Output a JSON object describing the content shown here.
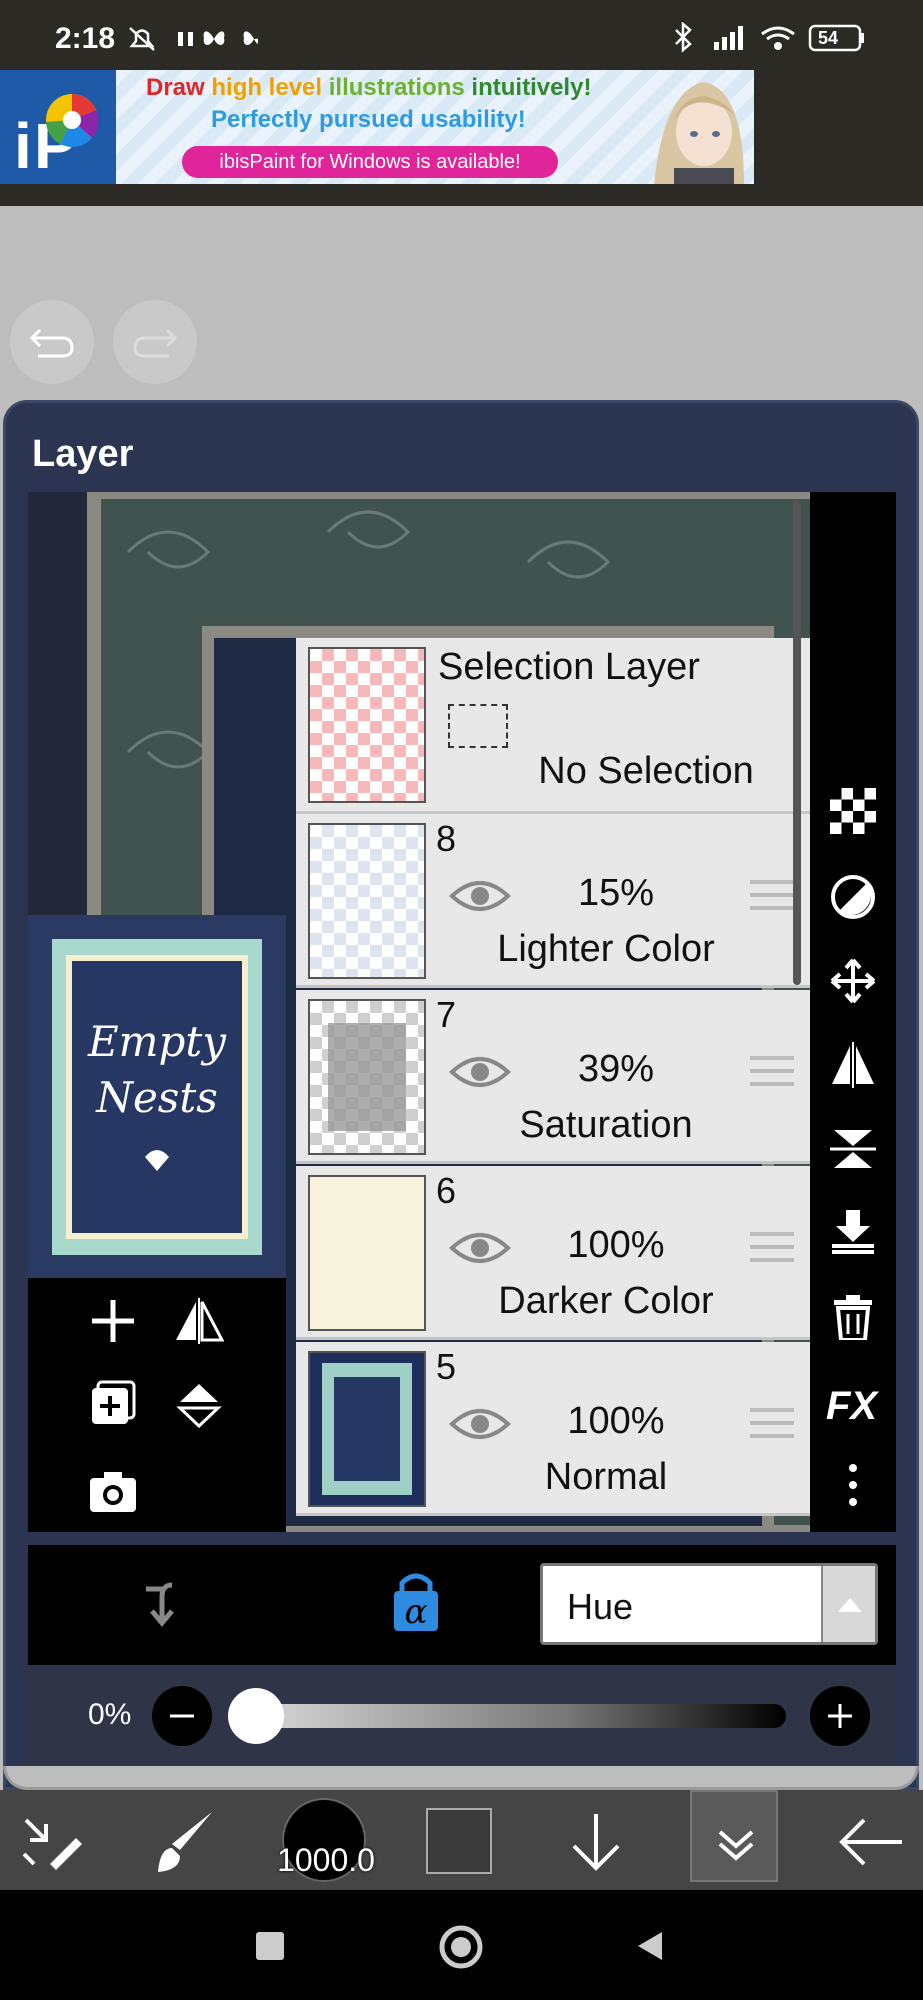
{
  "status_bar": {
    "time": "2:18",
    "battery": "54"
  },
  "ad": {
    "line1_parts": [
      "Draw ",
      "high level ",
      "illustrations ",
      "intuitively!"
    ],
    "line2": "Perfectly pursued usability!",
    "pill": "ibisPaint for Windows is available!"
  },
  "panel": {
    "title": "Layer"
  },
  "selection_layer": {
    "name": "Selection Layer",
    "status": "No Selection"
  },
  "layers": [
    {
      "number": "8",
      "opacity": "15%",
      "mode": "Lighter Color"
    },
    {
      "number": "7",
      "opacity": "39%",
      "mode": "Saturation"
    },
    {
      "number": "6",
      "opacity": "100%",
      "mode": "Darker Color"
    },
    {
      "number": "5",
      "opacity": "100%",
      "mode": "Normal"
    }
  ],
  "preview": {
    "title_line1": "Empty",
    "title_line2": "Nests"
  },
  "blend": {
    "selected": "Hue"
  },
  "opacity_slider": {
    "label": "0%",
    "value": 0
  },
  "brush": {
    "size": "1000.0"
  },
  "colors": {
    "panel": "#2b3552",
    "accent_blue": "#2e8be0",
    "toolbar": "#454545"
  },
  "icons": [
    "undo-icon",
    "redo-icon",
    "checker-icon",
    "half-circle-icon",
    "move-icon",
    "flip-horizontal-icon",
    "flip-vertical-icon",
    "merge-down-icon",
    "trash-icon",
    "fx-icon",
    "more-icon",
    "add-layer-icon",
    "duplicate-layer-icon",
    "camera-icon",
    "clip-icon",
    "alpha-lock-icon",
    "eye-icon",
    "transform-icon",
    "brush-icon",
    "down-arrow-icon",
    "collapse-icon",
    "back-arrow-icon"
  ]
}
